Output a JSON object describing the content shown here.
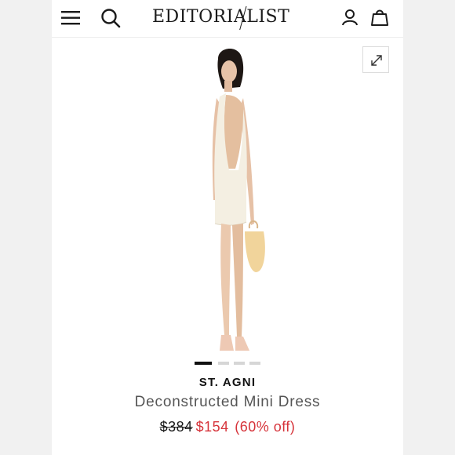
{
  "header": {
    "logo_text": "EDITORIALIST",
    "menu_icon": "hamburger-menu-icon",
    "search_icon": "search-icon",
    "account_icon": "user-icon",
    "bag_icon": "shopping-bag-icon"
  },
  "gallery": {
    "expand_icon": "expand-icon",
    "image_count": 4,
    "active_index": 0
  },
  "product": {
    "brand": "ST. AGNI",
    "name": "Deconstructed Mini Dress",
    "price_original": "$384",
    "price_sale": "$154",
    "discount": "(60% off)"
  },
  "colors": {
    "sale_red": "#d6333a",
    "text_dark": "#111111",
    "text_muted": "#555555"
  }
}
